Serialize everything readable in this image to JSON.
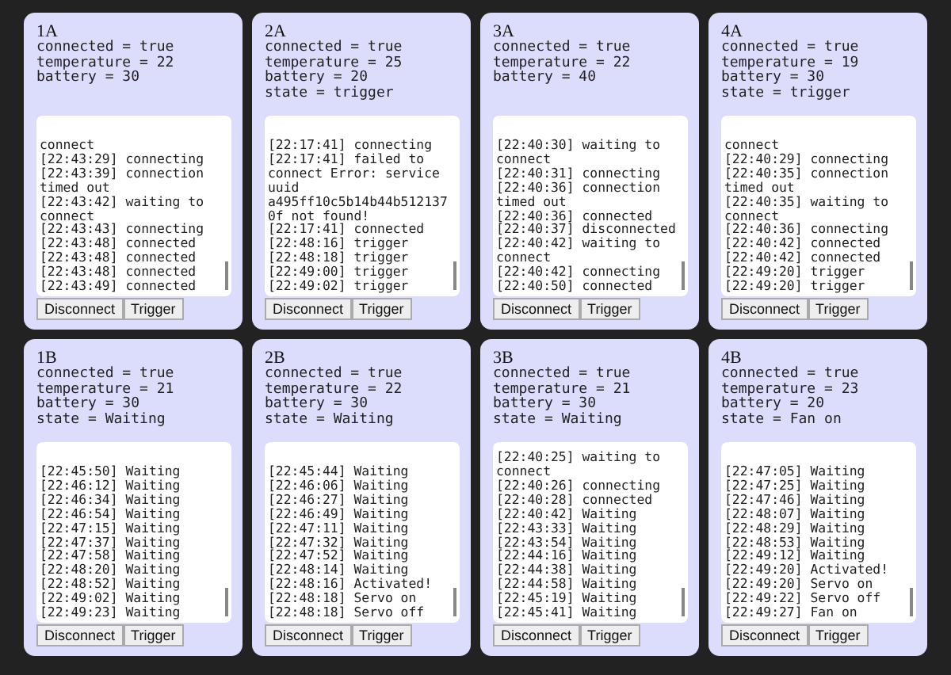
{
  "cards": [
    {
      "title": "1A",
      "fields": [
        "connected = true",
        "temperature = 22",
        "battery = 30"
      ],
      "log": [
        "connect",
        "[22:43:29] connecting",
        "[22:43:39] connection timed out",
        "[22:43:42] waiting to connect",
        "[22:43:43] connecting",
        "[22:43:48] connected",
        "[22:43:48] connected",
        "[22:43:48] connected",
        "[22:43:49] connected"
      ],
      "buttons": [
        "Disconnect",
        "Trigger"
      ]
    },
    {
      "title": "2A",
      "fields": [
        "connected = true",
        "temperature = 25",
        "battery = 20",
        "state = trigger"
      ],
      "log": [
        "[22:17:41] connecting",
        "[22:17:41] failed to connect Error: service uuid a495ff10c5b14b44b5121370f not found!",
        "[22:17:41] connected",
        "[22:48:16] trigger",
        "[22:48:18] trigger",
        "[22:49:00] trigger",
        "[22:49:02] trigger"
      ],
      "buttons": [
        "Disconnect",
        "Trigger"
      ]
    },
    {
      "title": "3A",
      "fields": [
        "connected = true",
        "temperature = 22",
        "battery = 40"
      ],
      "log": [
        "[22:40:30] waiting to connect",
        "[22:40:31] connecting",
        "[22:40:36] connection timed out",
        "[22:40:36] connected",
        "[22:40:37] disconnected",
        "[22:40:42] waiting to connect",
        "[22:40:42] connecting",
        "[22:40:50] connected"
      ],
      "buttons": [
        "Disconnect",
        "Trigger"
      ]
    },
    {
      "title": "4A",
      "fields": [
        "connected = true",
        "temperature = 19",
        "battery = 30",
        "state = trigger"
      ],
      "log": [
        "connect",
        "[22:40:29] connecting",
        "[22:40:35] connection timed out",
        "[22:40:35] waiting to connect",
        "[22:40:36] connecting",
        "[22:40:42] connected",
        "[22:40:42] connected",
        "[22:49:20] trigger",
        "[22:49:20] trigger"
      ],
      "buttons": [
        "Disconnect",
        "Trigger"
      ]
    },
    {
      "title": "1B",
      "fields": [
        "connected = true",
        "temperature = 21",
        "battery = 30",
        "state = Waiting"
      ],
      "log": [
        "[22:45:50] Waiting",
        "[22:46:12] Waiting",
        "[22:46:34] Waiting",
        "[22:46:54] Waiting",
        "[22:47:15] Waiting",
        "[22:47:37] Waiting",
        "[22:47:58] Waiting",
        "[22:48:20] Waiting",
        "[22:48:52] Waiting",
        "[22:49:02] Waiting",
        "[22:49:23] Waiting"
      ],
      "buttons": [
        "Disconnect",
        "Trigger"
      ]
    },
    {
      "title": "2B",
      "fields": [
        "connected = true",
        "temperature = 22",
        "battery = 30",
        "state = Waiting"
      ],
      "log": [
        "[22:45:44] Waiting",
        "[22:46:06] Waiting",
        "[22:46:27] Waiting",
        "[22:46:49] Waiting",
        "[22:47:11] Waiting",
        "[22:47:32] Waiting",
        "[22:47:52] Waiting",
        "[22:48:14] Waiting",
        "[22:48:16] Activated!",
        "[22:48:18] Servo on",
        "[22:48:18] Servo off"
      ],
      "buttons": [
        "Disconnect",
        "Trigger"
      ]
    },
    {
      "title": "3B",
      "fields": [
        "connected = true",
        "temperature = 21",
        "battery = 30",
        "state = Waiting"
      ],
      "log": [
        "[22:40:25] waiting to connect",
        "[22:40:26] connecting",
        "[22:40:28] connected",
        "[22:40:42] Waiting",
        "[22:43:33] Waiting",
        "[22:43:54] Waiting",
        "[22:44:16] Waiting",
        "[22:44:38] Waiting",
        "[22:44:58] Waiting",
        "[22:45:19] Waiting",
        "[22:45:41] Waiting"
      ],
      "buttons": [
        "Disconnect",
        "Trigger"
      ]
    },
    {
      "title": "4B",
      "fields": [
        "connected = true",
        "temperature = 23",
        "battery = 20",
        "state = Fan on"
      ],
      "log": [
        "[22:47:05] Waiting",
        "[22:47:25] Waiting",
        "[22:47:46] Waiting",
        "[22:48:07] Waiting",
        "[22:48:29] Waiting",
        "[22:48:53] Waiting",
        "[22:49:12] Waiting",
        "[22:49:20] Activated!",
        "[22:49:20] Servo on",
        "[22:49:22] Servo off",
        "[22:49:27] Fan on"
      ],
      "buttons": [
        "Disconnect",
        "Trigger"
      ]
    }
  ]
}
